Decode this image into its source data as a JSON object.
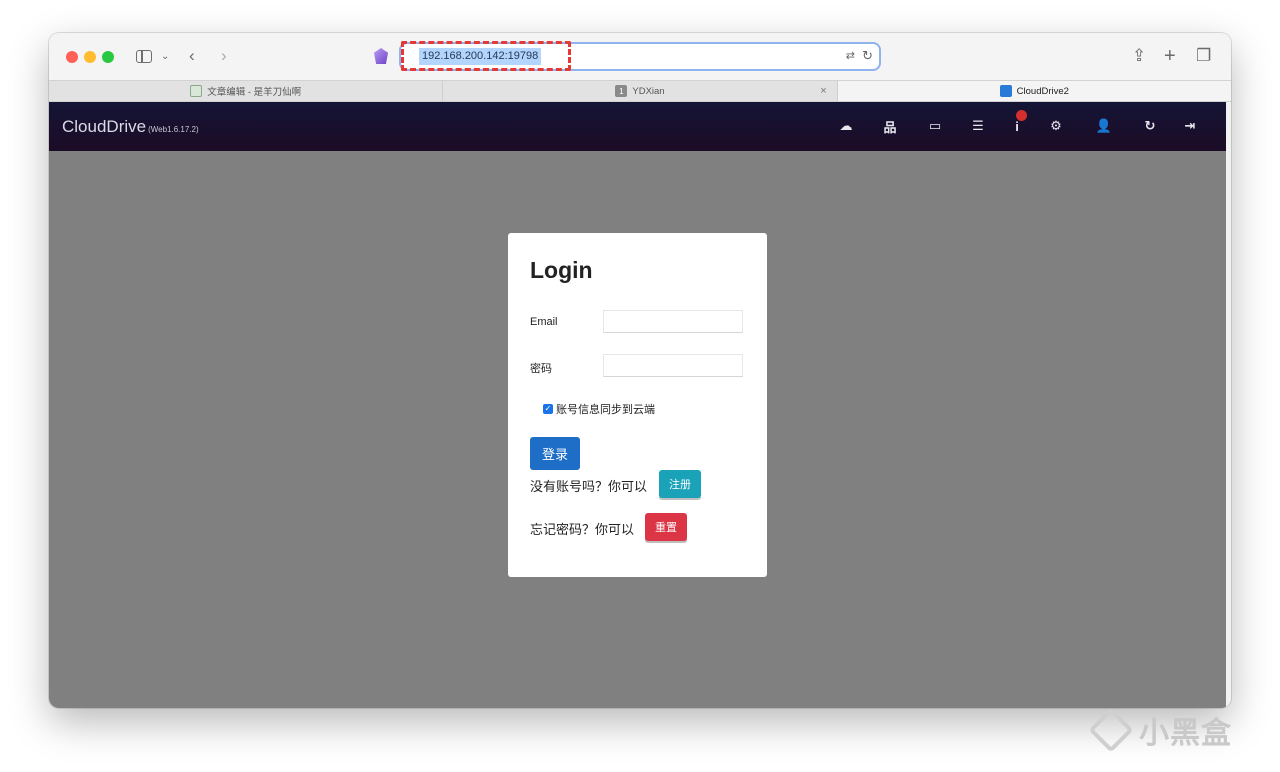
{
  "browser": {
    "url": "192.168.200.142:19798",
    "tabs": [
      {
        "label": "文章编辑 - 是羊刀仙啊",
        "icon": "document-icon"
      },
      {
        "label": "YDXian",
        "badge": "1",
        "icon": "number-badge-icon"
      },
      {
        "label": "CloudDrive2",
        "icon": "cloud-icon",
        "active": true
      }
    ],
    "close_glyph": "×"
  },
  "app": {
    "brand": "CloudDrive",
    "version": "(Web1.6.17.2)",
    "notification_count": "",
    "nav_icons": [
      "cloud-upload-icon",
      "network-icon",
      "monitor-icon",
      "tasks-icon",
      "info-icon",
      "settings-icon",
      "add-user-icon",
      "refresh-icon",
      "logout-icon"
    ]
  },
  "login": {
    "title": "Login",
    "email_label": "Email",
    "email_value": "",
    "password_label": "密码",
    "password_value": "",
    "sync_label": "账号信息同步到云端",
    "sync_checked": true,
    "login_button": "登录",
    "no_account_text": "没有账号吗？你可以",
    "register_button": "注册",
    "forgot_text": "忘记密码？你可以",
    "reset_button": "重置"
  },
  "colors": {
    "header_top": "#141535",
    "header_bottom": "#1c0b26",
    "content_bg": "#808080",
    "login_button": "#1e6ec8",
    "register_button": "#19a2b8",
    "reset_button": "#dc3545",
    "highlight_box": "#e53935"
  },
  "watermark": "小黑盒"
}
